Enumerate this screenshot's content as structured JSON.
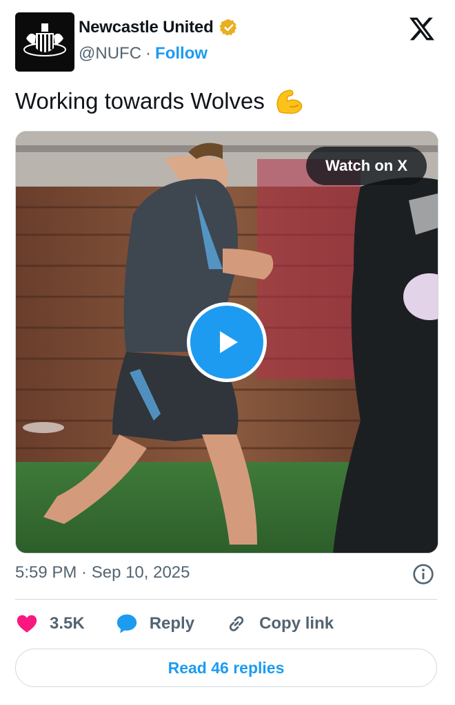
{
  "author": {
    "name": "Newcastle United",
    "handle": "@NUFC",
    "separator": "·",
    "follow_label": "Follow"
  },
  "tweet": {
    "text": "Working towards Wolves"
  },
  "media": {
    "watch_label": "Watch on X"
  },
  "meta": {
    "timestamp": "5:59 PM · Sep 10, 2025"
  },
  "actions": {
    "like_count": "3.5K",
    "reply_label": "Reply",
    "copy_label": "Copy link"
  },
  "read_replies_label": "Read 46 replies",
  "colors": {
    "accent": "#1d9bf0",
    "like": "#f91880",
    "verified": "#e8b021"
  },
  "icons": [
    "nufc-crest-icon",
    "verified-badge-icon",
    "x-logo-icon",
    "flexed-biceps-emoji-icon",
    "play-icon",
    "info-icon",
    "heart-icon",
    "reply-bubble-icon",
    "link-icon"
  ]
}
